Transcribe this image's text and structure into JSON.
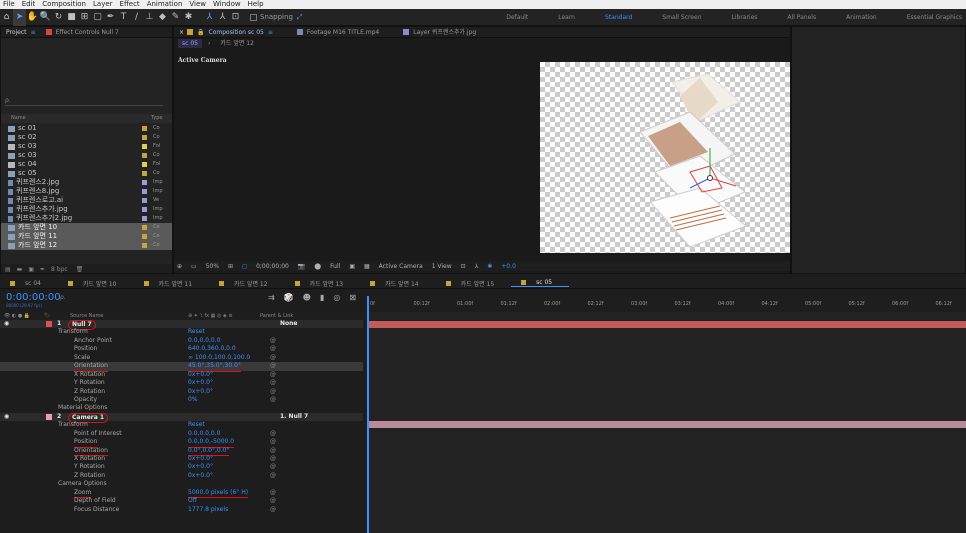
{
  "menu": [
    "File",
    "Edit",
    "Composition",
    "Layer",
    "Effect",
    "Animation",
    "View",
    "Window",
    "Help"
  ],
  "toolbar": {
    "snapping_label": "Snapping",
    "workspaces": [
      "Default",
      "Learn",
      "Standard",
      "Small Screen",
      "Libraries",
      "All Panels",
      "Animation",
      "Essential Graphics"
    ],
    "active_workspace": "Standard"
  },
  "project_panel": {
    "tabs": [
      "Project",
      "Effect Controls Null 7"
    ],
    "search_placeholder": "ρ.",
    "headers": {
      "name": "Name",
      "type": "Type"
    },
    "items": [
      {
        "name": "sc 01",
        "kind": "comp",
        "type": "Co",
        "label_color": "#c9a23a",
        "selected": false
      },
      {
        "name": "sc 02",
        "kind": "comp",
        "type": "Co",
        "label_color": "#c9a23a",
        "selected": false
      },
      {
        "name": "sc 03",
        "kind": "folder",
        "type": "Fol",
        "label_color": "#e0d050",
        "selected": false
      },
      {
        "name": "sc 03",
        "kind": "comp",
        "type": "Co",
        "label_color": "#c9a23a",
        "selected": false
      },
      {
        "name": "sc 04",
        "kind": "folder",
        "type": "Fol",
        "label_color": "#e0d050",
        "selected": false
      },
      {
        "name": "sc 05",
        "kind": "comp",
        "type": "Co",
        "label_color": "#c9a23a",
        "selected": false
      },
      {
        "name": "퀴프렌스2.jpg",
        "kind": "file",
        "type": "Imp",
        "label_color": "#9a9ad8",
        "selected": false
      },
      {
        "name": "퀴프렌스8.jpg",
        "kind": "file",
        "type": "Imp",
        "label_color": "#9a9ad8",
        "selected": false
      },
      {
        "name": "퀴프렌스로고.ai",
        "kind": "file",
        "type": "Ve",
        "label_color": "#9a9ad8",
        "selected": false
      },
      {
        "name": "퀴프렌스추가.jpg",
        "kind": "file",
        "type": "Imp",
        "label_color": "#9a9ad8",
        "selected": false
      },
      {
        "name": "퀴프렌스추가2.jpg",
        "kind": "file",
        "type": "Imp",
        "label_color": "#9a9ad8",
        "selected": false
      },
      {
        "name": "카드 앞면 10",
        "kind": "comp",
        "type": "Co",
        "label_color": "#c9a23a",
        "selected": true
      },
      {
        "name": "카드 앞면 11",
        "kind": "comp",
        "type": "Co",
        "label_color": "#c9a23a",
        "selected": true
      },
      {
        "name": "카드 앞면 12",
        "kind": "comp",
        "type": "Co",
        "label_color": "#c9a23a",
        "selected": true
      }
    ],
    "bpc": "8 bpc"
  },
  "composition": {
    "tabs": [
      "Composition sc 05",
      "Footage M16 TITLE.mp4",
      "Layer 퀴프렌스추가.jpg"
    ],
    "breadcrumbs": [
      "sc 05",
      "카드 앞면 12"
    ],
    "view_label": "Active Camera",
    "footer": {
      "zoom": "50%",
      "timecode": "0;00;00;00",
      "resolution": "Full",
      "camera": "Active Camera",
      "views": "1 View",
      "exposure": "+0.0"
    }
  },
  "timeline": {
    "tabs": [
      "sc 04",
      "카드 앞면 10",
      "카드 앞면 11",
      "카드 앞면 12",
      "카드 앞면 13",
      "카드 앞면 14",
      "카드 앞면 15",
      "sc 05"
    ],
    "active_tab": "sc 05",
    "timecode": "0:00:00:00",
    "fps_label": "00000 (29.97 fps)",
    "search_placeholder": "ρ.",
    "column_headers": {
      "source_name": "Source Name",
      "parent": "Parent & Link"
    },
    "ruler": [
      "0f",
      "00:12f",
      "01:00f",
      "01:12f",
      "02:00f",
      "02:12f",
      "03:00f",
      "03:12f",
      "04:00f",
      "04:12f",
      "05:00f",
      "05:12f",
      "06:00f",
      "06:12f"
    ],
    "rows": [
      {
        "type": "layer",
        "num": "1",
        "name": "Null 7",
        "parent": "None",
        "swatch": "#e05050",
        "circled": true
      },
      {
        "type": "group",
        "name": "Transform",
        "value": "Reset"
      },
      {
        "type": "prop",
        "name": "Anchor Point",
        "value": "0.0,0.0,0.0"
      },
      {
        "type": "prop",
        "name": "Position",
        "value": "640.0,360.0,0.0"
      },
      {
        "type": "prop",
        "name": "Scale",
        "value": "∞ 100.0,100.0,100.0"
      },
      {
        "type": "prop",
        "name": "Orientation",
        "value": "45.0°,35.0°,30.0°",
        "highlight": true,
        "underline": true
      },
      {
        "type": "prop",
        "name": "X Rotation",
        "value": "0x+0.0°"
      },
      {
        "type": "prop",
        "name": "Y Rotation",
        "value": "0x+0.0°"
      },
      {
        "type": "prop",
        "name": "Z Rotation",
        "value": "0x+0.0°"
      },
      {
        "type": "prop",
        "name": "Opacity",
        "value": "0%"
      },
      {
        "type": "group",
        "name": "Material Options",
        "value": ""
      },
      {
        "type": "layer",
        "num": "2",
        "name": "Camera 1",
        "parent": "1. Null 7",
        "swatch": "#e8a0b0",
        "circled": true
      },
      {
        "type": "group",
        "name": "Transform",
        "value": "Reset"
      },
      {
        "type": "prop",
        "name": "Point of Interest",
        "value": "0.0,0.0,0.0"
      },
      {
        "type": "prop",
        "name": "Position",
        "value": "0.0,0.0,-5000.0",
        "underline": true
      },
      {
        "type": "prop",
        "name": "Orientation",
        "value": "0.0°,0.0°,0.0°",
        "underline": true
      },
      {
        "type": "prop",
        "name": "X Rotation",
        "value": "0x+0.0°"
      },
      {
        "type": "prop",
        "name": "Y Rotation",
        "value": "0x+0.0°"
      },
      {
        "type": "prop",
        "name": "Z Rotation",
        "value": "0x+0.0°"
      },
      {
        "type": "group",
        "name": "Camera Options",
        "value": ""
      },
      {
        "type": "prop",
        "name": "Zoom",
        "value": "5000.0 pixels (6° H)",
        "underline": true
      },
      {
        "type": "prop",
        "name": "Depth of Field",
        "value": "Off"
      },
      {
        "type": "prop",
        "name": "Focus Distance",
        "value": "1777.8 pixels"
      }
    ],
    "track_colors": {
      "null": "#c55a5a",
      "camera": "#b88a9a"
    }
  }
}
